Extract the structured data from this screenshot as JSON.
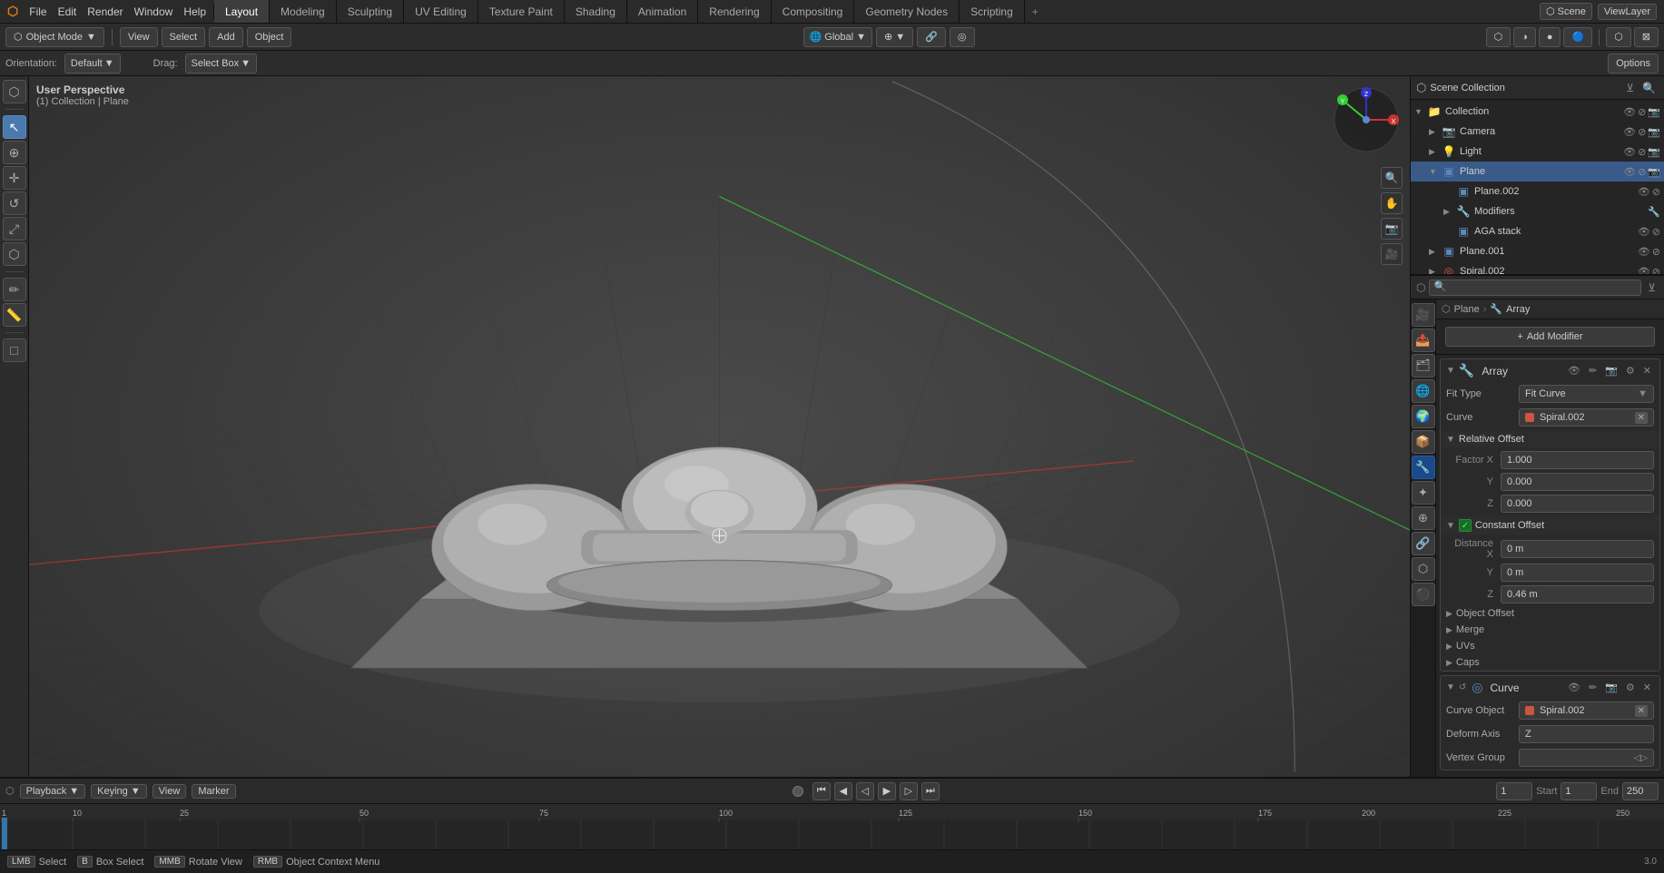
{
  "topbar": {
    "file": "File",
    "edit": "Edit",
    "render": "Render",
    "window": "Window",
    "help": "Help"
  },
  "workspace_tabs": [
    {
      "label": "Layout",
      "active": true
    },
    {
      "label": "Modeling",
      "active": false
    },
    {
      "label": "Sculpting",
      "active": false
    },
    {
      "label": "UV Editing",
      "active": false
    },
    {
      "label": "Texture Paint",
      "active": false
    },
    {
      "label": "Shading",
      "active": false
    },
    {
      "label": "Animation",
      "active": false
    },
    {
      "label": "Rendering",
      "active": false
    },
    {
      "label": "Compositing",
      "active": false
    },
    {
      "label": "Geometry Nodes",
      "active": false
    },
    {
      "label": "Scripting",
      "active": false
    }
  ],
  "toolbar": {
    "mode": "Object Mode",
    "view": "View",
    "select": "Select",
    "add": "Add",
    "object": "Object",
    "orientation": "Orientation:",
    "orientation_val": "Default",
    "drag": "Drag:",
    "drag_val": "Select Box",
    "options": "Options"
  },
  "viewport_info": {
    "perspective": "User Perspective",
    "collection": "(1) Collection | Plane"
  },
  "outliner": {
    "title": "Scene Collection",
    "items": [
      {
        "label": "Collection",
        "icon": "📁",
        "indent": 0,
        "expanded": true
      },
      {
        "label": "Camera",
        "icon": "📷",
        "indent": 1,
        "color": "#88aadd"
      },
      {
        "label": "Light",
        "icon": "💡",
        "indent": 1,
        "color": "#ddcc66"
      },
      {
        "label": "Plane",
        "icon": "▣",
        "indent": 1,
        "expanded": true,
        "color": "#5a8abd",
        "selected": true
      },
      {
        "label": "Plane.002",
        "icon": "▣",
        "indent": 2,
        "color": "#888"
      },
      {
        "label": "Modifiers",
        "icon": "🔧",
        "indent": 2,
        "color": "#888"
      },
      {
        "label": "AGA stack",
        "icon": "▣",
        "indent": 2,
        "color": "#888"
      },
      {
        "label": "Plane.001",
        "icon": "▣",
        "indent": 1,
        "color": "#5a8abd"
      },
      {
        "label": "Spiral.002",
        "icon": "◎",
        "indent": 1,
        "color": "#dd5544"
      }
    ]
  },
  "properties": {
    "breadcrumb_plane": "Plane",
    "breadcrumb_array": "Array",
    "add_modifier": "Add Modifier",
    "modifier_name": "Array",
    "fit_type_label": "Fit Type",
    "fit_type_val": "Fit Curve",
    "curve_label": "Curve",
    "curve_val": "Spiral.002",
    "relative_offset_label": "Relative Offset",
    "factor_x_label": "Factor X",
    "factor_x_val": "1.000",
    "factor_y_label": "Y",
    "factor_y_val": "0.000",
    "factor_z_label": "Z",
    "factor_z_val": "0.000",
    "constant_offset_label": "Constant Offset",
    "dist_x_label": "Distance X",
    "dist_x_val": "0 m",
    "dist_y_label": "Y",
    "dist_y_val": "0 m",
    "dist_z_label": "Z",
    "dist_z_val": "0.46 m",
    "object_offset_label": "Object Offset",
    "merge_label": "Merge",
    "uvs_label": "UVs",
    "caps_label": "Caps",
    "curve_modifier_label": "Curve",
    "curve_object_label": "Curve Object",
    "curve_object_val": "Spiral.002",
    "deform_axis_label": "Deform Axis",
    "deform_axis_val": "Z",
    "vertex_group_label": "Vertex Group"
  },
  "timeline": {
    "playback": "Playback",
    "keying": "Keying",
    "view": "View",
    "marker": "Marker",
    "frame_current": "1",
    "start_label": "Start",
    "start_val": "1",
    "end_label": "End",
    "end_val": "250",
    "frame_numbers": [
      "1",
      "10",
      "25",
      "50",
      "75",
      "100",
      "125",
      "150",
      "175",
      "200",
      "225",
      "250"
    ]
  },
  "status_bar": {
    "select": "Select",
    "box_select": "Box Select",
    "rotate_view": "Rotate View",
    "object_context_menu": "Object Context Menu"
  },
  "icons": {
    "expand_right": "▶",
    "expand_down": "▼",
    "wrench": "🔧",
    "camera": "📷",
    "light": "💡",
    "mesh": "⬡",
    "curve": "◎",
    "scene": "🌐",
    "object_data": "▣",
    "modifier": "🔧",
    "material": "⚫",
    "physics": "⊕",
    "render": "🎥",
    "output": "📤",
    "view_layer": "🗂",
    "scene_icon": "🌐",
    "world": "🌍",
    "object": "📦",
    "constraint": "🔗",
    "particle": "✦",
    "filter": "⊻",
    "search": "🔍"
  }
}
